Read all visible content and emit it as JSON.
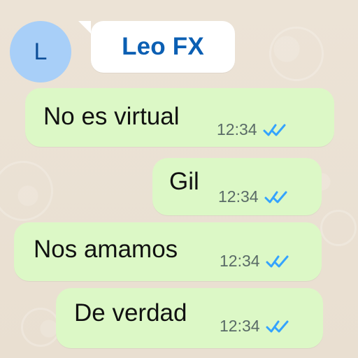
{
  "header": {
    "avatar_initial": "L",
    "contact_name": "Leo FX"
  },
  "messages": [
    {
      "text": "No es virtual",
      "time": "12:34",
      "status_icon": "double-check-icon"
    },
    {
      "text": "Gil",
      "time": "12:34",
      "status_icon": "double-check-icon"
    },
    {
      "text": "Nos amamos",
      "time": "12:34",
      "status_icon": "double-check-icon"
    },
    {
      "text": "De verdad",
      "time": "12:34",
      "status_icon": "double-check-icon"
    }
  ],
  "colors": {
    "background": "#ece3d6",
    "message_bubble": "#dcf8c6",
    "name_bubble": "#ffffff",
    "avatar": "#a8cff8",
    "contact_name": "#0b5fb3",
    "read_ticks": "#34a3ff"
  }
}
